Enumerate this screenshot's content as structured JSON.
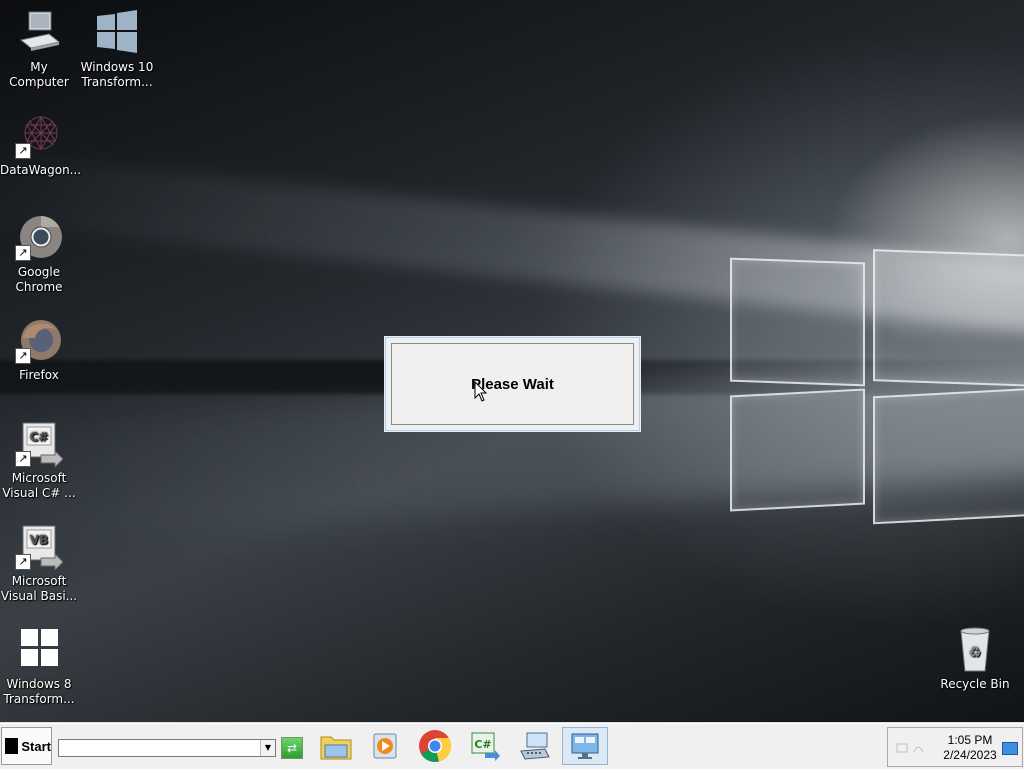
{
  "desktop": {
    "icons_left": [
      {
        "id": "my-computer",
        "label": "My Computer",
        "shortcut": false
      },
      {
        "id": "win10-transform",
        "label": "Windows 10 Transform...",
        "shortcut": false
      },
      {
        "id": "datawagon",
        "label": "DataWagon...",
        "shortcut": true
      },
      {
        "id": "google-chrome",
        "label": "Google Chrome",
        "shortcut": true
      },
      {
        "id": "firefox",
        "label": "Firefox",
        "shortcut": true
      },
      {
        "id": "visual-csharp",
        "label": "Microsoft Visual C# ...",
        "shortcut": true
      },
      {
        "id": "visual-basic",
        "label": "Microsoft Visual Basi...",
        "shortcut": true
      },
      {
        "id": "win8-transform",
        "label": "Windows 8 Transform...",
        "shortcut": false
      }
    ],
    "recycle_bin": {
      "label": "Recycle Bin"
    }
  },
  "dialog": {
    "message": "Please Wait"
  },
  "taskbar": {
    "start_label": "Start",
    "address_value": "",
    "pinned": [
      "file-explorer-icon",
      "media-player-icon",
      "chrome-icon",
      "csharp-icon",
      "keyboard-monitor-icon",
      "remote-desktop-icon"
    ],
    "clock": {
      "time": "1:05 PM",
      "date": "2/24/2023"
    }
  },
  "colors": {
    "dialog_bg": "#f0f0f0",
    "taskbar_bg": "#f0f0f0",
    "active_task": "#dce9f5"
  }
}
